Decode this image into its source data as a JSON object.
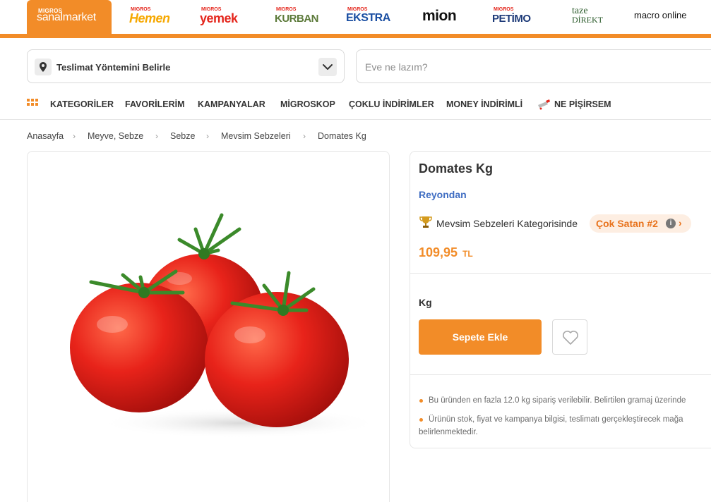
{
  "brands": {
    "active": {
      "small": "MIGROS",
      "name": "sanalmarket"
    },
    "hemen": {
      "small": "MIGROS",
      "name": "Hemen",
      "color": "#f6a800"
    },
    "yemek": {
      "small": "MIGROS",
      "name": "yemek",
      "color": "#e4261c"
    },
    "kurban": {
      "small": "MIGROS",
      "name": "KURBAN",
      "color": "#5c7a3a"
    },
    "ekstra": {
      "small": "MIGROS",
      "name": "EKSTRA",
      "color": "#1a4ea2"
    },
    "mion": {
      "name": "mion",
      "color": "#111111"
    },
    "petimo": {
      "small": "MIGROS",
      "name": "PETİMO",
      "color": "#1d3a78"
    },
    "taze": {
      "line1": "taze",
      "line2": "DİREKT",
      "color": "#2a5a2a"
    },
    "macro": {
      "name": "macro online",
      "color": "#111111"
    }
  },
  "delivery": {
    "label": "Teslimat Yöntemini Belirle"
  },
  "search": {
    "placeholder": "Eve ne lazım?"
  },
  "nav": {
    "items": [
      "KATEGORİLER",
      "FAVORİLERİM",
      "KAMPANYALAR",
      "MİGROSKOP",
      "ÇOKLU İNDİRİMLER",
      "MONEY İNDİRİMLİ",
      "NE PİŞİRSEM"
    ]
  },
  "breadcrumb": [
    "Anasayfa",
    "Meyve, Sebze",
    "Sebze",
    "Mevsim Sebzeleri",
    "Domates Kg"
  ],
  "product": {
    "title": "Domates Kg",
    "brand": "Reyondan",
    "category_text": "Mevsim Sebzeleri Kategorisinde",
    "bestseller": "Çok Satan #2",
    "price": "109,95",
    "currency": "TL",
    "unit": "Kg",
    "add_to_cart": "Sepete Ekle",
    "notes": [
      "Bu üründen en fazla 12.0 kg sipariş verilebilir. Belirtilen gramaj üzerinde",
      "Ürünün stok, fiyat ve kampanya bilgisi, teslimatı gerçekleştirecek mağa",
      "belirlenmektedir."
    ]
  },
  "colors": {
    "accent": "#f28c28",
    "link": "#3f6dc2",
    "bestseller_bg": "#fdeee2"
  }
}
